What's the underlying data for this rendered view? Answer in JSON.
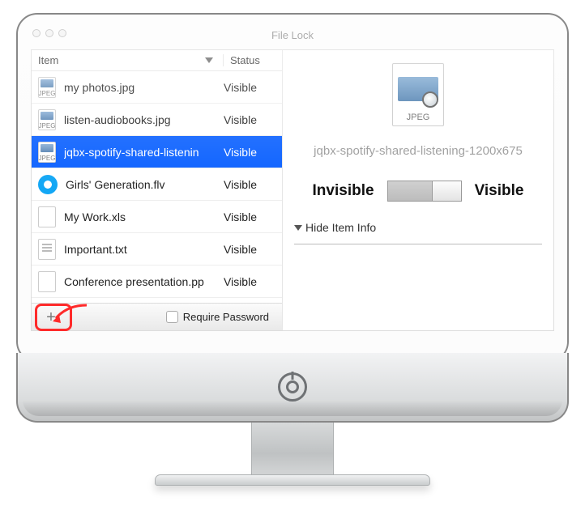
{
  "window": {
    "title": "File Lock"
  },
  "columns": {
    "item": "Item",
    "status": "Status"
  },
  "items": [
    {
      "name": "my photos.jpg",
      "status": "Visible",
      "icon": "jpeg",
      "selected": false
    },
    {
      "name": "listen-audiobooks.jpg",
      "status": "Visible",
      "icon": "jpeg",
      "selected": false
    },
    {
      "name": "jqbx-spotify-shared-listenin",
      "status": "Visible",
      "icon": "jpeg",
      "selected": true
    },
    {
      "name": "Girls' Generation.flv",
      "status": "Visible",
      "icon": "flv",
      "selected": false
    },
    {
      "name": "My Work.xls",
      "status": "Visible",
      "icon": "blank",
      "selected": false
    },
    {
      "name": "Important.txt",
      "status": "Visible",
      "icon": "txt",
      "selected": false
    },
    {
      "name": "Conference presentation.pp",
      "status": "Visible",
      "icon": "blank",
      "selected": false
    }
  ],
  "footer": {
    "require_password": "Require Password"
  },
  "detail": {
    "icon_label": "JPEG",
    "filename": "jqbx-spotify-shared-listening-1200x675",
    "invisible_label": "Invisible",
    "visible_label": "Visible",
    "state": "Visible",
    "hide_info": "Hide Item Info"
  }
}
